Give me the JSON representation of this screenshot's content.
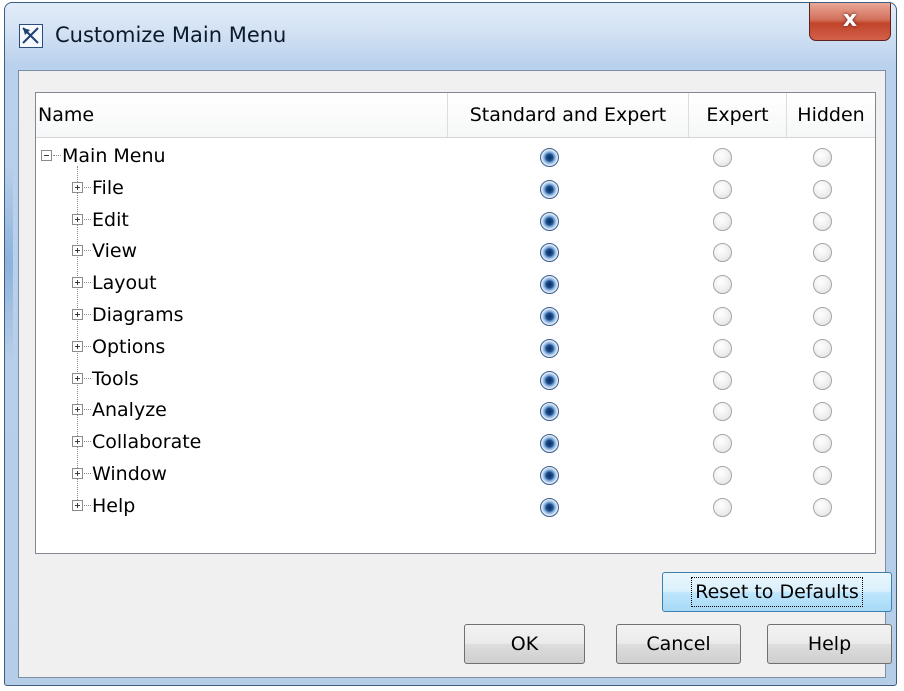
{
  "window": {
    "title": "Customize Main Menu",
    "close_label": "x",
    "icon": "dialog-app-icon"
  },
  "table": {
    "columns": [
      "Name",
      "Standard and Expert",
      "Expert",
      "Hidden"
    ],
    "root": {
      "label": "Main Menu",
      "expanded": true,
      "selected": "Standard and Expert"
    },
    "rows": [
      {
        "label": "File",
        "selected": "Standard and Expert"
      },
      {
        "label": "Edit",
        "selected": "Standard and Expert"
      },
      {
        "label": "View",
        "selected": "Standard and Expert"
      },
      {
        "label": "Layout",
        "selected": "Standard and Expert"
      },
      {
        "label": "Diagrams",
        "selected": "Standard and Expert"
      },
      {
        "label": "Options",
        "selected": "Standard and Expert"
      },
      {
        "label": "Tools",
        "selected": "Standard and Expert"
      },
      {
        "label": "Analyze",
        "selected": "Standard and Expert"
      },
      {
        "label": "Collaborate",
        "selected": "Standard and Expert"
      },
      {
        "label": "Window",
        "selected": "Standard and Expert"
      },
      {
        "label": "Help",
        "selected": "Standard and Expert"
      }
    ]
  },
  "buttons": {
    "reset": "Reset to Defaults",
    "ok": "OK",
    "cancel": "Cancel",
    "help": "Help"
  },
  "colors": {
    "title_bar": "#c7d9ef",
    "close_button": "#c8452c",
    "selected_radio": "#1d4f8d"
  }
}
